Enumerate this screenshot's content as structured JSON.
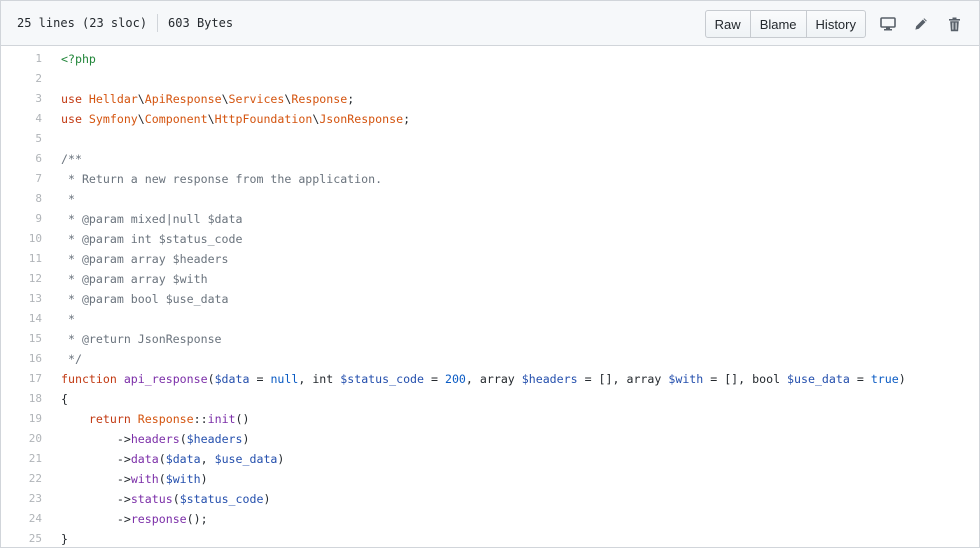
{
  "file_info": {
    "lines": "25 lines (23 sloc)",
    "size": "603 Bytes"
  },
  "actions": {
    "raw": "Raw",
    "blame": "Blame",
    "history": "History",
    "icons": [
      "desktop-icon",
      "pencil-icon",
      "trash-icon"
    ]
  },
  "code_lines": [
    [
      {
        "t": "<?php",
        "c": "s"
      }
    ],
    [],
    [
      {
        "t": "use ",
        "c": "k"
      },
      {
        "t": "Helldar",
        "c": "o"
      },
      {
        "t": "\\"
      },
      {
        "t": "ApiResponse",
        "c": "o"
      },
      {
        "t": "\\"
      },
      {
        "t": "Services",
        "c": "o"
      },
      {
        "t": "\\"
      },
      {
        "t": "Response",
        "c": "o"
      },
      {
        "t": ";"
      }
    ],
    [
      {
        "t": "use ",
        "c": "k"
      },
      {
        "t": "Symfony",
        "c": "o"
      },
      {
        "t": "\\"
      },
      {
        "t": "Component",
        "c": "o"
      },
      {
        "t": "\\"
      },
      {
        "t": "HttpFoundation",
        "c": "o"
      },
      {
        "t": "\\"
      },
      {
        "t": "JsonResponse",
        "c": "o"
      },
      {
        "t": ";"
      }
    ],
    [],
    [
      {
        "t": "/**",
        "c": "c"
      }
    ],
    [
      {
        "t": " * Return a new response from the application.",
        "c": "c"
      }
    ],
    [
      {
        "t": " *",
        "c": "c"
      }
    ],
    [
      {
        "t": " * @param mixed|null $data",
        "c": "c"
      }
    ],
    [
      {
        "t": " * @param int $status_code",
        "c": "c"
      }
    ],
    [
      {
        "t": " * @param array $headers",
        "c": "c"
      }
    ],
    [
      {
        "t": " * @param array $with",
        "c": "c"
      }
    ],
    [
      {
        "t": " * @param bool $use_data",
        "c": "c"
      }
    ],
    [
      {
        "t": " *",
        "c": "c"
      }
    ],
    [
      {
        "t": " * @return JsonResponse",
        "c": "c"
      }
    ],
    [
      {
        "t": " */",
        "c": "c"
      }
    ],
    [
      {
        "t": "function ",
        "c": "k"
      },
      {
        "t": "api_response",
        "c": "f"
      },
      {
        "t": "("
      },
      {
        "t": "$data",
        "c": "v"
      },
      {
        "t": " = "
      },
      {
        "t": "null",
        "c": "n"
      },
      {
        "t": ", int "
      },
      {
        "t": "$status_code",
        "c": "v"
      },
      {
        "t": " = "
      },
      {
        "t": "200",
        "c": "n"
      },
      {
        "t": ", array "
      },
      {
        "t": "$headers",
        "c": "v"
      },
      {
        "t": " = [], array "
      },
      {
        "t": "$with",
        "c": "v"
      },
      {
        "t": " = [], bool "
      },
      {
        "t": "$use_data",
        "c": "v"
      },
      {
        "t": " = "
      },
      {
        "t": "true",
        "c": "n"
      },
      {
        "t": ")"
      }
    ],
    [
      {
        "t": "{"
      }
    ],
    [
      {
        "t": "    "
      },
      {
        "t": "return ",
        "c": "k"
      },
      {
        "t": "Response",
        "c": "o"
      },
      {
        "t": "::"
      },
      {
        "t": "init",
        "c": "f"
      },
      {
        "t": "()"
      }
    ],
    [
      {
        "t": "        ->"
      },
      {
        "t": "headers",
        "c": "f"
      },
      {
        "t": "("
      },
      {
        "t": "$headers",
        "c": "v"
      },
      {
        "t": ")"
      }
    ],
    [
      {
        "t": "        ->"
      },
      {
        "t": "data",
        "c": "f"
      },
      {
        "t": "("
      },
      {
        "t": "$data",
        "c": "v"
      },
      {
        "t": ", "
      },
      {
        "t": "$use_data",
        "c": "v"
      },
      {
        "t": ")"
      }
    ],
    [
      {
        "t": "        ->"
      },
      {
        "t": "with",
        "c": "f"
      },
      {
        "t": "("
      },
      {
        "t": "$with",
        "c": "v"
      },
      {
        "t": ")"
      }
    ],
    [
      {
        "t": "        ->"
      },
      {
        "t": "status",
        "c": "f"
      },
      {
        "t": "("
      },
      {
        "t": "$status_code",
        "c": "v"
      },
      {
        "t": ")"
      }
    ],
    [
      {
        "t": "        ->"
      },
      {
        "t": "response",
        "c": "f"
      },
      {
        "t": "();"
      }
    ],
    [
      {
        "t": "}"
      }
    ]
  ]
}
